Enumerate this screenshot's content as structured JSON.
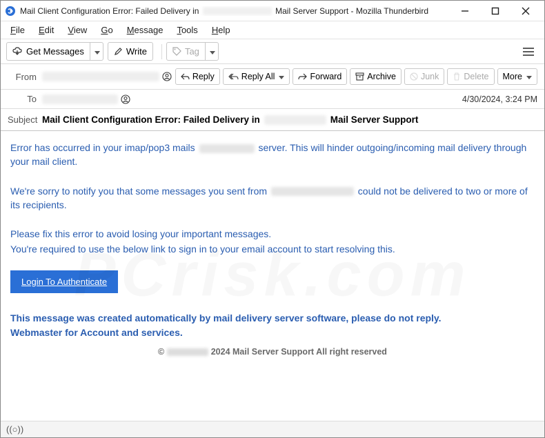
{
  "window": {
    "title_prefix": "Mail Client Configuration Error: Failed Delivery in",
    "title_suffix": "Mail Server Support - Mozilla Thunderbird"
  },
  "menu": {
    "file": "File",
    "edit": "Edit",
    "view": "View",
    "go": "Go",
    "message": "Message",
    "tools": "Tools",
    "help": "Help"
  },
  "toolbar": {
    "get_messages": "Get Messages",
    "write": "Write",
    "tag": "Tag"
  },
  "header": {
    "from_label": "From",
    "to_label": "To",
    "subject_label": "Subject",
    "subject_prefix": "Mail Client Configuration Error: Failed Delivery in",
    "subject_suffix": "Mail Server Support",
    "date": "4/30/2024, 3:24 PM"
  },
  "actions": {
    "reply": "Reply",
    "reply_all": "Reply All",
    "forward": "Forward",
    "archive": "Archive",
    "junk": "Junk",
    "delete": "Delete",
    "more": "More"
  },
  "body": {
    "p1a": "Error has occurred in your imap/pop3 mails",
    "p1b": "server. This will hinder outgoing/incoming mail delivery through your mail client.",
    "p2a": "We're sorry to notify you that some messages you sent from",
    "p2b": "could not be delivered to two or more of its recipients.",
    "p3": "Please fix this error to avoid losing your important messages.",
    "p4": "You're required to use the below link to sign in to your email account to start resolving this.",
    "login_btn": "Login To Authenticate",
    "auto1": "This message was created automatically by mail delivery server software, please do not reply.",
    "auto2": "Webmaster for Account and services.",
    "copyright": "2024 Mail Server Support All right reserved"
  },
  "status": {
    "conn": "((○))"
  }
}
